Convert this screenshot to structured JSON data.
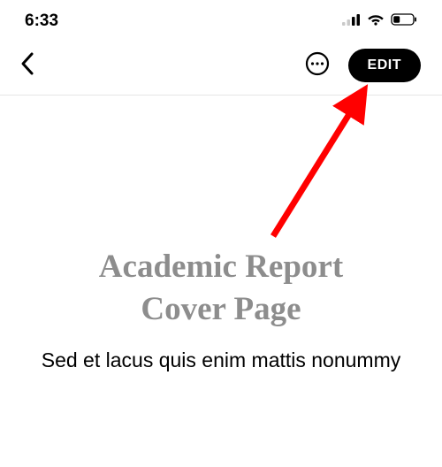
{
  "status_bar": {
    "time": "6:33"
  },
  "nav": {
    "edit_label": "EDIT"
  },
  "document": {
    "title_line1": "Academic Report",
    "title_line2": "Cover Page",
    "subtitle": "Sed et lacus quis enim mattis nonummy"
  },
  "annotation": {
    "arrow_color": "#ff0000"
  }
}
